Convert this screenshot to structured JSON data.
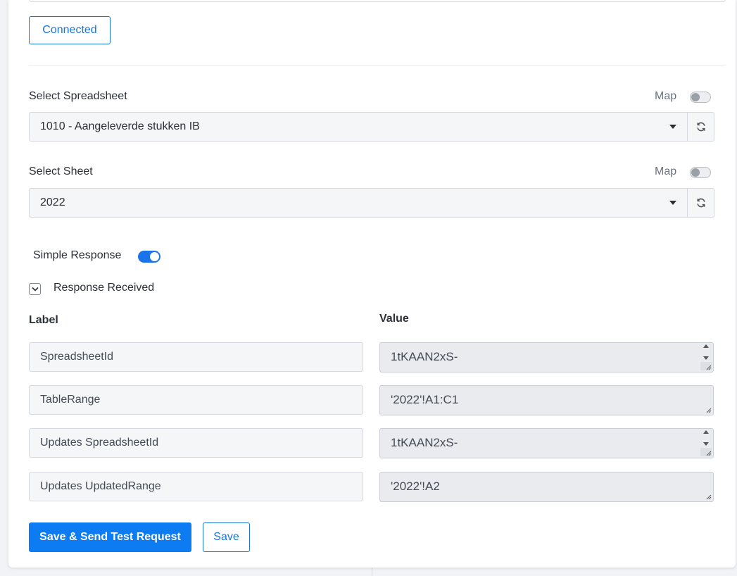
{
  "connection": {
    "status_label": "Connected"
  },
  "spreadsheet": {
    "label": "Select Spreadsheet",
    "map_label": "Map",
    "selected": "1010 - Aangeleverde stukken IB"
  },
  "sheet": {
    "label": "Select Sheet",
    "map_label": "Map",
    "selected": "2022"
  },
  "simple_response": {
    "label": "Simple Response",
    "enabled": true
  },
  "response_received": {
    "label": "Response Received"
  },
  "table": {
    "label_header": "Label",
    "value_header": "Value",
    "rows": [
      {
        "label": "SpreadsheetId",
        "value": "1tKAAN2xS-"
      },
      {
        "label": "TableRange",
        "value": "'2022'!A1:C1"
      },
      {
        "label": "Updates SpreadsheetId",
        "value": "1tKAAN2xS-"
      },
      {
        "label": "Updates UpdatedRange",
        "value": "'2022'!A2"
      }
    ]
  },
  "actions": {
    "save_send_label": "Save & Send Test Request",
    "save_label": "Save"
  },
  "colors": {
    "accent": "#0d7cf2",
    "border": "#d5d9df",
    "field_bg": "#f4f6f8"
  },
  "icons": {
    "refresh": "refresh-icon",
    "dropdown": "caret-down-icon",
    "collapse": "chevron-down-icon"
  }
}
